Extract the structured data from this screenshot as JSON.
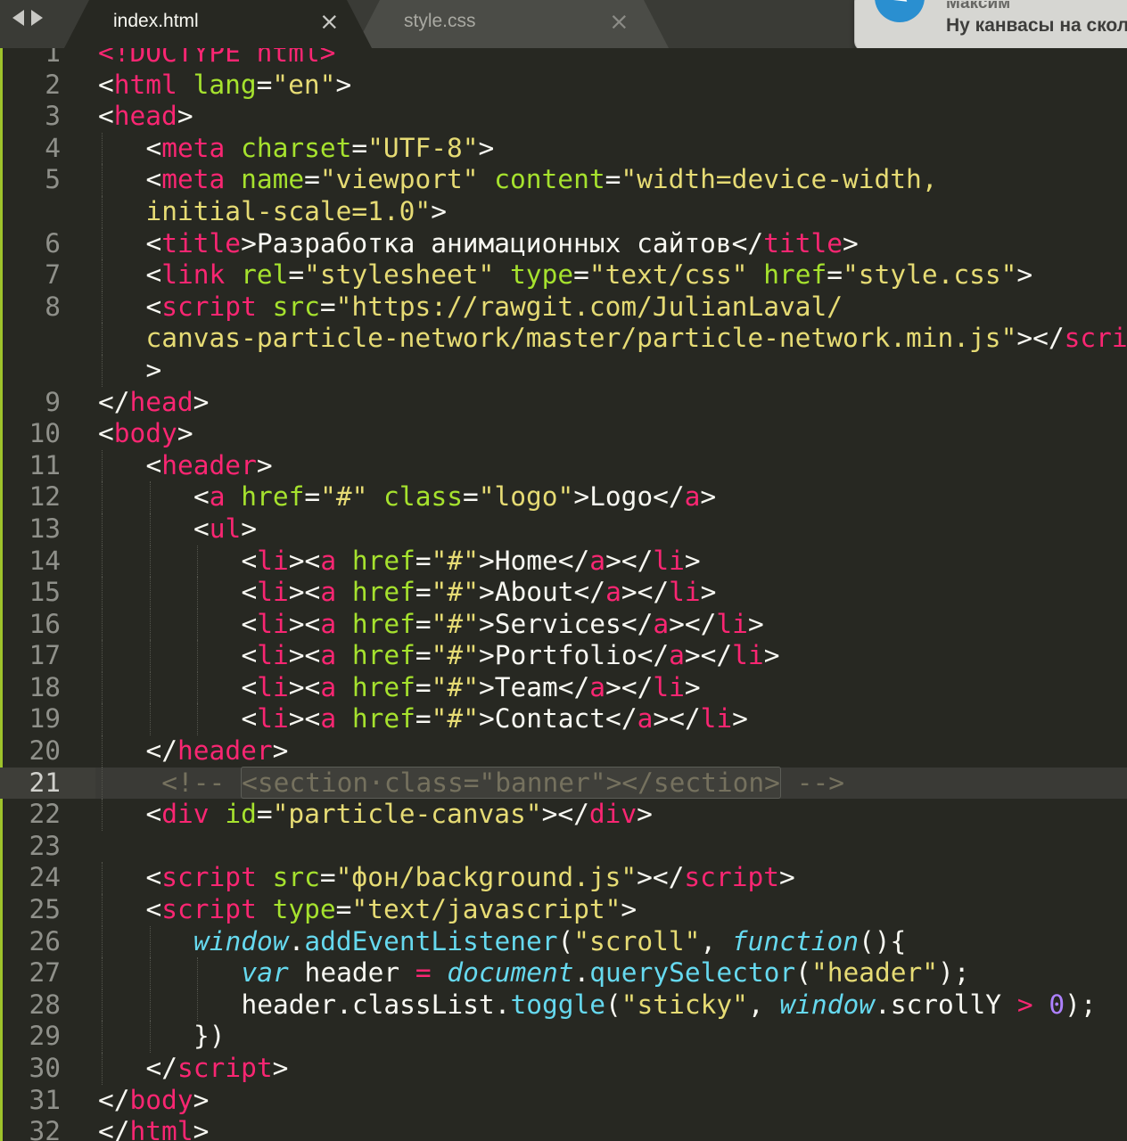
{
  "tabs": [
    {
      "label": "index.html",
      "active": true
    },
    {
      "label": "style.css",
      "active": false
    }
  ],
  "close_glyph": "×",
  "notification": {
    "sender": "Максим",
    "text": "Ну канвасы на скол"
  },
  "current_line": 21,
  "lines": [
    {
      "n": "1",
      "indent": 0,
      "tokens": [
        [
          "t",
          "<!DOCTYPE html>"
        ]
      ]
    },
    {
      "n": "2",
      "indent": 0,
      "tokens": [
        [
          "w",
          "<"
        ],
        [
          "t",
          "html"
        ],
        [
          "w",
          " "
        ],
        [
          "at",
          "lang"
        ],
        [
          "w",
          "="
        ],
        [
          "s",
          "\"en\""
        ],
        [
          "w",
          ">"
        ]
      ]
    },
    {
      "n": "3",
      "indent": 0,
      "tokens": [
        [
          "w",
          "<"
        ],
        [
          "t",
          "head"
        ],
        [
          "w",
          ">"
        ]
      ]
    },
    {
      "n": "4",
      "indent": 1,
      "tokens": [
        [
          "w",
          "<"
        ],
        [
          "t",
          "meta"
        ],
        [
          "w",
          " "
        ],
        [
          "at",
          "charset"
        ],
        [
          "w",
          "="
        ],
        [
          "s",
          "\"UTF-8\""
        ],
        [
          "w",
          ">"
        ]
      ]
    },
    {
      "n": "5",
      "indent": 1,
      "tokens": [
        [
          "w",
          "<"
        ],
        [
          "t",
          "meta"
        ],
        [
          "w",
          " "
        ],
        [
          "at",
          "name"
        ],
        [
          "w",
          "="
        ],
        [
          "s",
          "\"viewport\""
        ],
        [
          "w",
          " "
        ],
        [
          "at",
          "content"
        ],
        [
          "w",
          "="
        ],
        [
          "s",
          "\"width=device-width,"
        ]
      ]
    },
    {
      "n": "",
      "indent": 1,
      "tokens": [
        [
          "s",
          "initial-scale=1.0\""
        ],
        [
          "w",
          ">"
        ]
      ]
    },
    {
      "n": "6",
      "indent": 1,
      "tokens": [
        [
          "w",
          "<"
        ],
        [
          "t",
          "title"
        ],
        [
          "w",
          ">Разработка анимационных сайтов</"
        ],
        [
          "t",
          "title"
        ],
        [
          "w",
          ">"
        ]
      ]
    },
    {
      "n": "7",
      "indent": 1,
      "tokens": [
        [
          "w",
          "<"
        ],
        [
          "t",
          "link"
        ],
        [
          "w",
          " "
        ],
        [
          "at",
          "rel"
        ],
        [
          "w",
          "="
        ],
        [
          "s",
          "\"stylesheet\""
        ],
        [
          "w",
          " "
        ],
        [
          "at",
          "type"
        ],
        [
          "w",
          "="
        ],
        [
          "s",
          "\"text/css\""
        ],
        [
          "w",
          " "
        ],
        [
          "at",
          "href"
        ],
        [
          "w",
          "="
        ],
        [
          "s",
          "\"style.css\""
        ],
        [
          "w",
          ">"
        ]
      ]
    },
    {
      "n": "8",
      "indent": 1,
      "tokens": [
        [
          "w",
          "<"
        ],
        [
          "t",
          "script"
        ],
        [
          "w",
          " "
        ],
        [
          "at",
          "src"
        ],
        [
          "w",
          "="
        ],
        [
          "s",
          "\"https://rawgit.com/JulianLaval/"
        ]
      ]
    },
    {
      "n": "",
      "indent": 1,
      "tokens": [
        [
          "s",
          "canvas-particle-network/master/particle-network.min.js\""
        ],
        [
          "w",
          "></"
        ],
        [
          "t",
          "script"
        ]
      ]
    },
    {
      "n": "",
      "indent": 1,
      "tokens": [
        [
          "w",
          ">"
        ]
      ]
    },
    {
      "n": "9",
      "indent": 0,
      "tokens": [
        [
          "w",
          "</"
        ],
        [
          "t",
          "head"
        ],
        [
          "w",
          ">"
        ]
      ]
    },
    {
      "n": "10",
      "indent": 0,
      "tokens": [
        [
          "w",
          "<"
        ],
        [
          "t",
          "body"
        ],
        [
          "w",
          ">"
        ]
      ]
    },
    {
      "n": "11",
      "indent": 1,
      "tokens": [
        [
          "w",
          "<"
        ],
        [
          "t",
          "header"
        ],
        [
          "w",
          ">"
        ]
      ]
    },
    {
      "n": "12",
      "indent": 2,
      "tokens": [
        [
          "w",
          "<"
        ],
        [
          "t",
          "a"
        ],
        [
          "w",
          " "
        ],
        [
          "at",
          "href"
        ],
        [
          "w",
          "="
        ],
        [
          "s",
          "\"#\""
        ],
        [
          "w",
          " "
        ],
        [
          "at",
          "class"
        ],
        [
          "w",
          "="
        ],
        [
          "s",
          "\"logo\""
        ],
        [
          "w",
          ">Logo</"
        ],
        [
          "t",
          "a"
        ],
        [
          "w",
          ">"
        ]
      ]
    },
    {
      "n": "13",
      "indent": 2,
      "tokens": [
        [
          "w",
          "<"
        ],
        [
          "t",
          "ul"
        ],
        [
          "w",
          ">"
        ]
      ]
    },
    {
      "n": "14",
      "indent": 3,
      "tokens": [
        [
          "w",
          "<"
        ],
        [
          "t",
          "li"
        ],
        [
          "w",
          "><"
        ],
        [
          "t",
          "a"
        ],
        [
          "w",
          " "
        ],
        [
          "at",
          "href"
        ],
        [
          "w",
          "="
        ],
        [
          "s",
          "\"#\""
        ],
        [
          "w",
          ">Home</"
        ],
        [
          "t",
          "a"
        ],
        [
          "w",
          "></"
        ],
        [
          "t",
          "li"
        ],
        [
          "w",
          ">"
        ]
      ]
    },
    {
      "n": "15",
      "indent": 3,
      "tokens": [
        [
          "w",
          "<"
        ],
        [
          "t",
          "li"
        ],
        [
          "w",
          "><"
        ],
        [
          "t",
          "a"
        ],
        [
          "w",
          " "
        ],
        [
          "at",
          "href"
        ],
        [
          "w",
          "="
        ],
        [
          "s",
          "\"#\""
        ],
        [
          "w",
          ">About</"
        ],
        [
          "t",
          "a"
        ],
        [
          "w",
          "></"
        ],
        [
          "t",
          "li"
        ],
        [
          "w",
          ">"
        ]
      ]
    },
    {
      "n": "16",
      "indent": 3,
      "tokens": [
        [
          "w",
          "<"
        ],
        [
          "t",
          "li"
        ],
        [
          "w",
          "><"
        ],
        [
          "t",
          "a"
        ],
        [
          "w",
          " "
        ],
        [
          "at",
          "href"
        ],
        [
          "w",
          "="
        ],
        [
          "s",
          "\"#\""
        ],
        [
          "w",
          ">Services</"
        ],
        [
          "t",
          "a"
        ],
        [
          "w",
          "></"
        ],
        [
          "t",
          "li"
        ],
        [
          "w",
          ">"
        ]
      ]
    },
    {
      "n": "17",
      "indent": 3,
      "tokens": [
        [
          "w",
          "<"
        ],
        [
          "t",
          "li"
        ],
        [
          "w",
          "><"
        ],
        [
          "t",
          "a"
        ],
        [
          "w",
          " "
        ],
        [
          "at",
          "href"
        ],
        [
          "w",
          "="
        ],
        [
          "s",
          "\"#\""
        ],
        [
          "w",
          ">Portfolio</"
        ],
        [
          "t",
          "a"
        ],
        [
          "w",
          "></"
        ],
        [
          "t",
          "li"
        ],
        [
          "w",
          ">"
        ]
      ]
    },
    {
      "n": "18",
      "indent": 3,
      "tokens": [
        [
          "w",
          "<"
        ],
        [
          "t",
          "li"
        ],
        [
          "w",
          "><"
        ],
        [
          "t",
          "a"
        ],
        [
          "w",
          " "
        ],
        [
          "at",
          "href"
        ],
        [
          "w",
          "="
        ],
        [
          "s",
          "\"#\""
        ],
        [
          "w",
          ">Team</"
        ],
        [
          "t",
          "a"
        ],
        [
          "w",
          "></"
        ],
        [
          "t",
          "li"
        ],
        [
          "w",
          ">"
        ]
      ]
    },
    {
      "n": "19",
      "indent": 3,
      "tokens": [
        [
          "w",
          "<"
        ],
        [
          "t",
          "li"
        ],
        [
          "w",
          "><"
        ],
        [
          "t",
          "a"
        ],
        [
          "w",
          " "
        ],
        [
          "at",
          "href"
        ],
        [
          "w",
          "="
        ],
        [
          "s",
          "\"#\""
        ],
        [
          "w",
          ">Contact</"
        ],
        [
          "t",
          "a"
        ],
        [
          "w",
          "></"
        ],
        [
          "t",
          "li"
        ],
        [
          "w",
          ">"
        ]
      ]
    },
    {
      "n": "20",
      "indent": 1,
      "tokens": [
        [
          "w",
          "</"
        ],
        [
          "t",
          "header"
        ],
        [
          "w",
          ">"
        ]
      ]
    },
    {
      "n": "21",
      "indent": 1,
      "tokens": [
        [
          "cm",
          " <!-- "
        ],
        [
          "sel",
          "<section·class=\"banner\"></section>"
        ],
        [
          "cm",
          " -->"
        ]
      ]
    },
    {
      "n": "22",
      "indent": 1,
      "tokens": [
        [
          "w",
          "<"
        ],
        [
          "t",
          "div"
        ],
        [
          "w",
          " "
        ],
        [
          "at",
          "id"
        ],
        [
          "w",
          "="
        ],
        [
          "s",
          "\"particle-canvas\""
        ],
        [
          "w",
          "></"
        ],
        [
          "t",
          "div"
        ],
        [
          "w",
          ">"
        ]
      ]
    },
    {
      "n": "23",
      "indent": 0,
      "tokens": []
    },
    {
      "n": "24",
      "indent": 1,
      "tokens": [
        [
          "w",
          "<"
        ],
        [
          "t",
          "script"
        ],
        [
          "w",
          " "
        ],
        [
          "at",
          "src"
        ],
        [
          "w",
          "="
        ],
        [
          "s",
          "\"фон/background.js\""
        ],
        [
          "w",
          "></"
        ],
        [
          "t",
          "script"
        ],
        [
          "w",
          ">"
        ]
      ]
    },
    {
      "n": "25",
      "indent": 1,
      "tokens": [
        [
          "w",
          "<"
        ],
        [
          "t",
          "script"
        ],
        [
          "w",
          " "
        ],
        [
          "at",
          "type"
        ],
        [
          "w",
          "="
        ],
        [
          "s",
          "\"text/javascript\""
        ],
        [
          "w",
          ">"
        ]
      ]
    },
    {
      "n": "26",
      "indent": 2,
      "tokens": [
        [
          "k",
          "window"
        ],
        [
          "w",
          "."
        ],
        [
          "f",
          "addEventListener"
        ],
        [
          "w",
          "("
        ],
        [
          "s",
          "\"scroll\""
        ],
        [
          "w",
          ", "
        ],
        [
          "k",
          "function"
        ],
        [
          "w",
          "(){"
        ]
      ]
    },
    {
      "n": "27",
      "indent": 3,
      "tokens": [
        [
          "k",
          "var"
        ],
        [
          "w",
          " header "
        ],
        [
          "t",
          "="
        ],
        [
          "w",
          " "
        ],
        [
          "k",
          "document"
        ],
        [
          "w",
          "."
        ],
        [
          "f",
          "querySelector"
        ],
        [
          "w",
          "("
        ],
        [
          "s",
          "\"header\""
        ],
        [
          "w",
          ");"
        ]
      ]
    },
    {
      "n": "28",
      "indent": 3,
      "tokens": [
        [
          "w",
          "header.classList."
        ],
        [
          "f",
          "toggle"
        ],
        [
          "w",
          "("
        ],
        [
          "s",
          "\"sticky\""
        ],
        [
          "w",
          ", "
        ],
        [
          "k",
          "window"
        ],
        [
          "w",
          ".scrollY "
        ],
        [
          "t",
          ">"
        ],
        [
          "w",
          " "
        ],
        [
          "n",
          "0"
        ],
        [
          "w",
          ");"
        ]
      ]
    },
    {
      "n": "29",
      "indent": 2,
      "tokens": [
        [
          "w",
          "})"
        ]
      ]
    },
    {
      "n": "30",
      "indent": 1,
      "tokens": [
        [
          "w",
          "</"
        ],
        [
          "t",
          "script"
        ],
        [
          "w",
          ">"
        ]
      ]
    },
    {
      "n": "31",
      "indent": 0,
      "tokens": [
        [
          "w",
          "</"
        ],
        [
          "t",
          "body"
        ],
        [
          "w",
          ">"
        ]
      ]
    },
    {
      "n": "32",
      "indent": 0,
      "tokens": [
        [
          "w",
          "</"
        ],
        [
          "t",
          "html"
        ],
        [
          "w",
          ">"
        ]
      ]
    }
  ]
}
